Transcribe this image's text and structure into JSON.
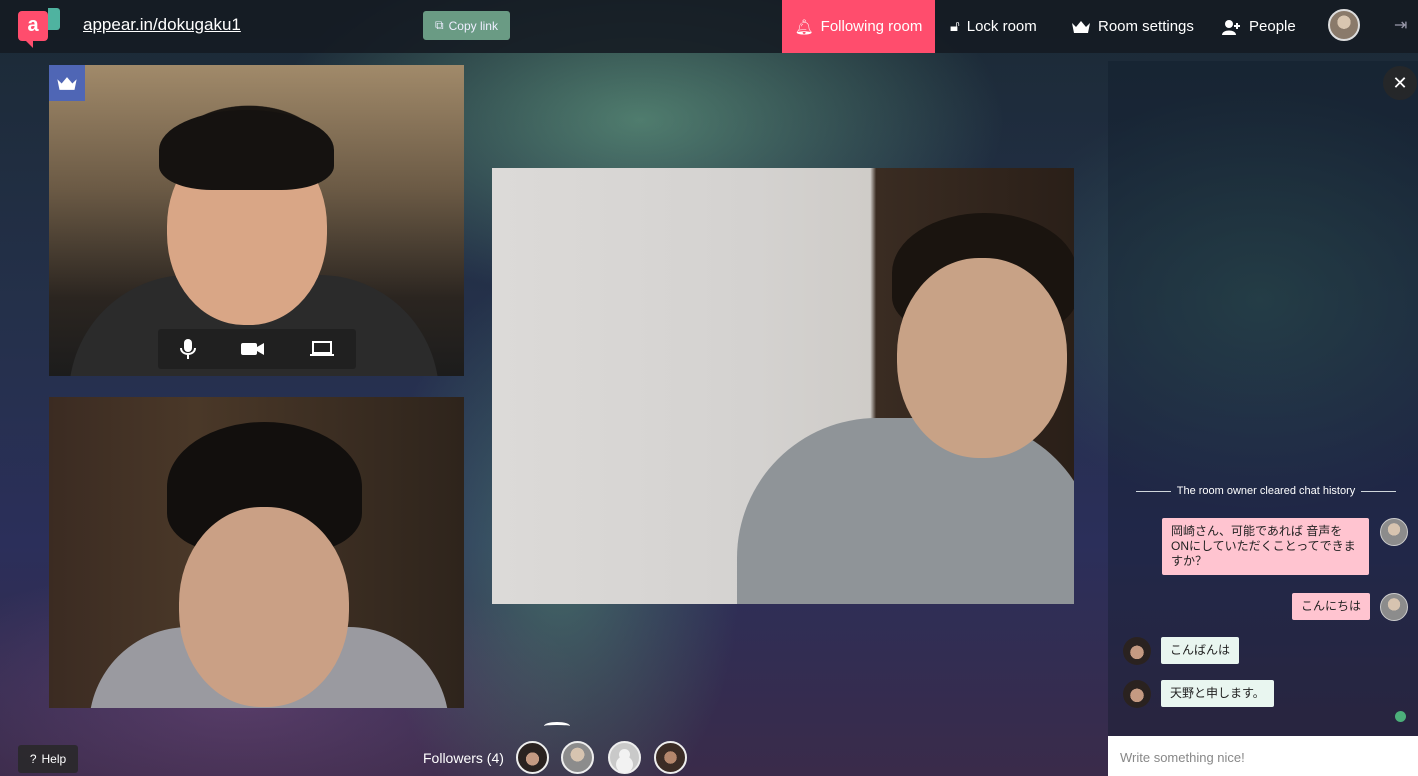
{
  "header": {
    "logo_glyph": "a",
    "room_url": "appear.in/dokugaku1",
    "copy_link_label": "Copy link",
    "nav": {
      "following_room": "Following room",
      "lock_room": "Lock room",
      "room_settings": "Room settings",
      "people": "People"
    }
  },
  "chat": {
    "system_notice": "The room owner cleared chat history",
    "messages": [
      {
        "text": "岡崎さん、可能であれば 音声をONにしていただくことってできますか？",
        "side": "me"
      },
      {
        "text": "こんにちは",
        "side": "me"
      },
      {
        "text": "こんばんは",
        "side": "them"
      },
      {
        "text": "天野と申します。",
        "side": "them"
      }
    ],
    "input_placeholder": "Write something nice!"
  },
  "footer": {
    "help_label": "Help",
    "followers_label": "Followers (4)"
  },
  "colors": {
    "accent": "#ff4d6d",
    "owner_badge": "#4f66b5",
    "copy_button": "#6a9b84"
  }
}
